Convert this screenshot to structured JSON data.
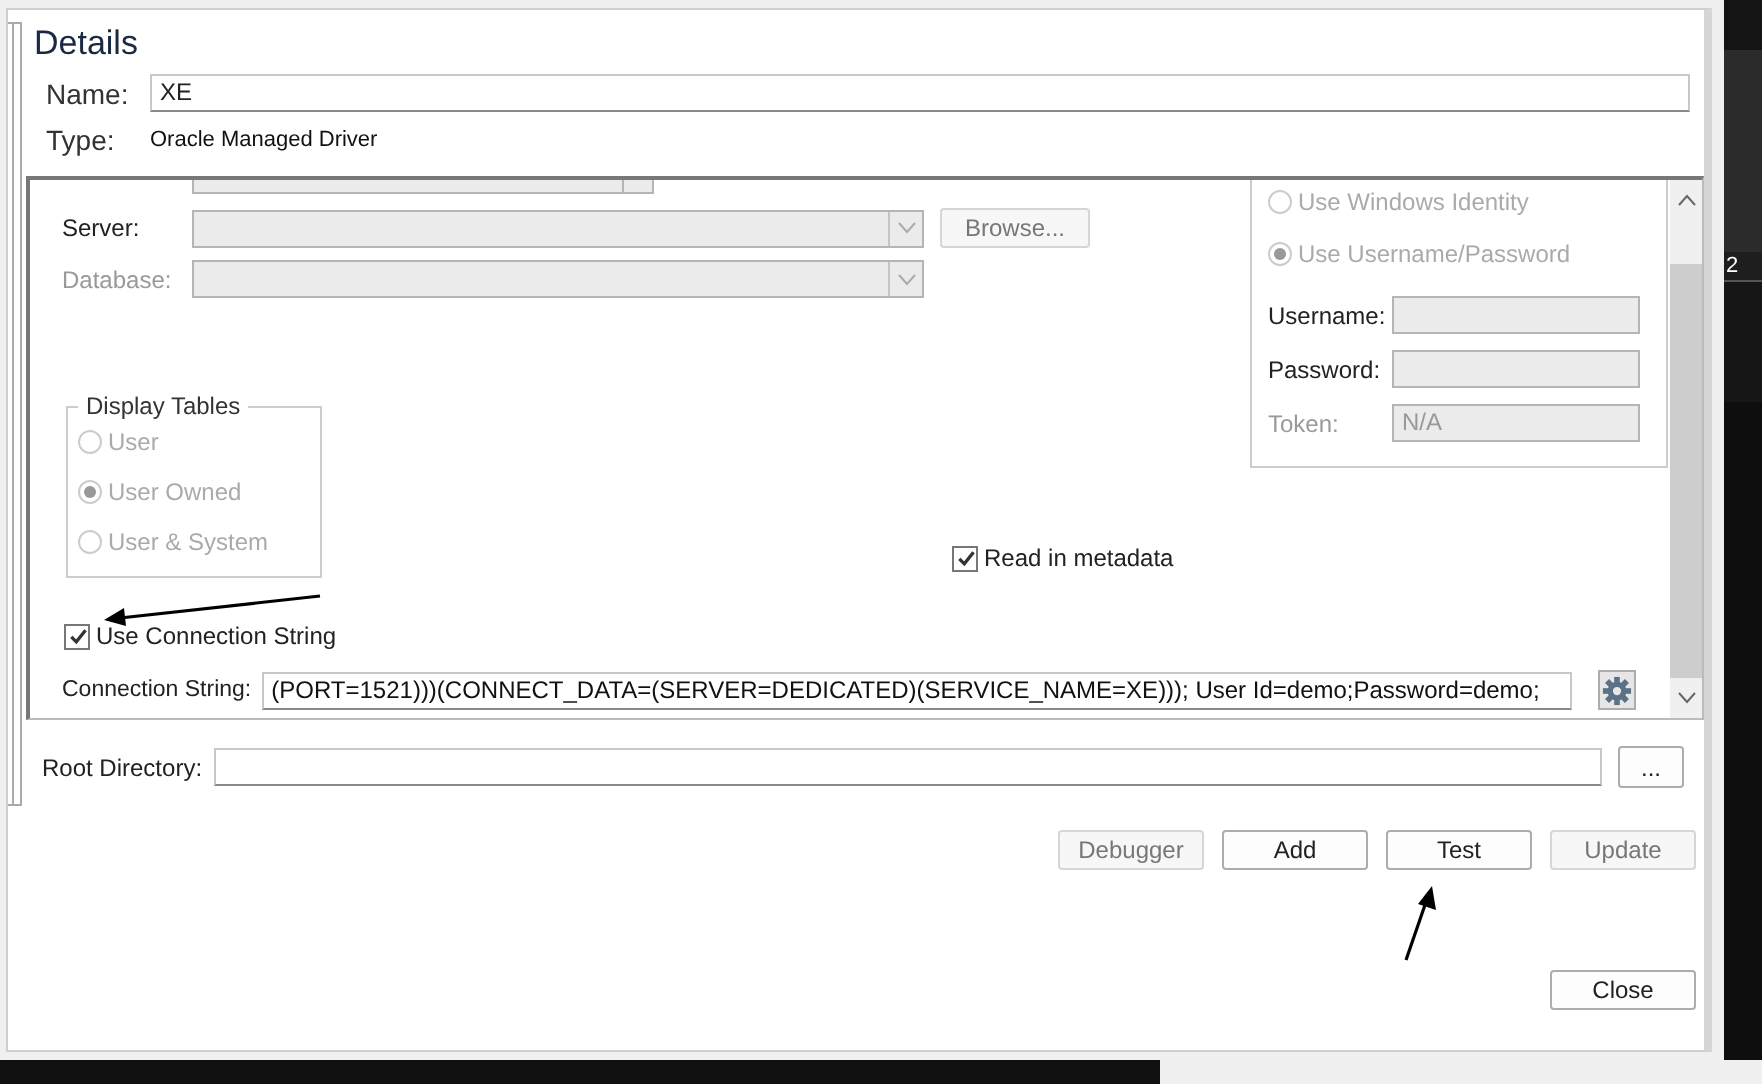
{
  "title": "Details",
  "name": {
    "label": "Name:",
    "value": "XE"
  },
  "type": {
    "label": "Type:",
    "value": "Oracle Managed Driver"
  },
  "connection": {
    "server": {
      "label": "Server:",
      "disabled": false
    },
    "database": {
      "label": "Database:",
      "disabled": true
    },
    "browse_button": {
      "label": "Browse...",
      "disabled": true
    },
    "display_tables": {
      "legend": "Display Tables",
      "options": [
        {
          "label": "User",
          "selected": false,
          "disabled": true
        },
        {
          "label": "User Owned",
          "selected": true,
          "disabled": true
        },
        {
          "label": "User & System",
          "selected": false,
          "disabled": true
        }
      ]
    },
    "read_in_metadata": {
      "label": "Read in metadata",
      "checked": true
    },
    "use_connection_string": {
      "label": "Use Connection String",
      "checked": true
    },
    "authentication": {
      "options": [
        {
          "label": "Use Windows Identity",
          "selected": false,
          "disabled": true
        },
        {
          "label": "Use Username/Password",
          "selected": true,
          "disabled": true
        }
      ],
      "fields": [
        {
          "label": "Username:",
          "disabled": false
        },
        {
          "label": "Password:",
          "disabled": false
        },
        {
          "label": "Token:",
          "value": "N/A",
          "disabled": true
        }
      ]
    },
    "connection_string": {
      "label": "Connection String:",
      "value": "(PORT=1521)))(CONNECT_DATA=(SERVER=DEDICATED)(SERVICE_NAME=XE))); User Id=demo;Password=demo;"
    }
  },
  "root_directory": {
    "label": "Root Directory:",
    "button": "..."
  },
  "buttons": [
    {
      "label": "Debugger",
      "disabled": true
    },
    {
      "label": "Add",
      "disabled": false
    },
    {
      "label": "Test",
      "disabled": false
    },
    {
      "label": "Update",
      "disabled": true
    }
  ],
  "close_button": {
    "label": "Close"
  },
  "side_window": {
    "text": "2"
  }
}
